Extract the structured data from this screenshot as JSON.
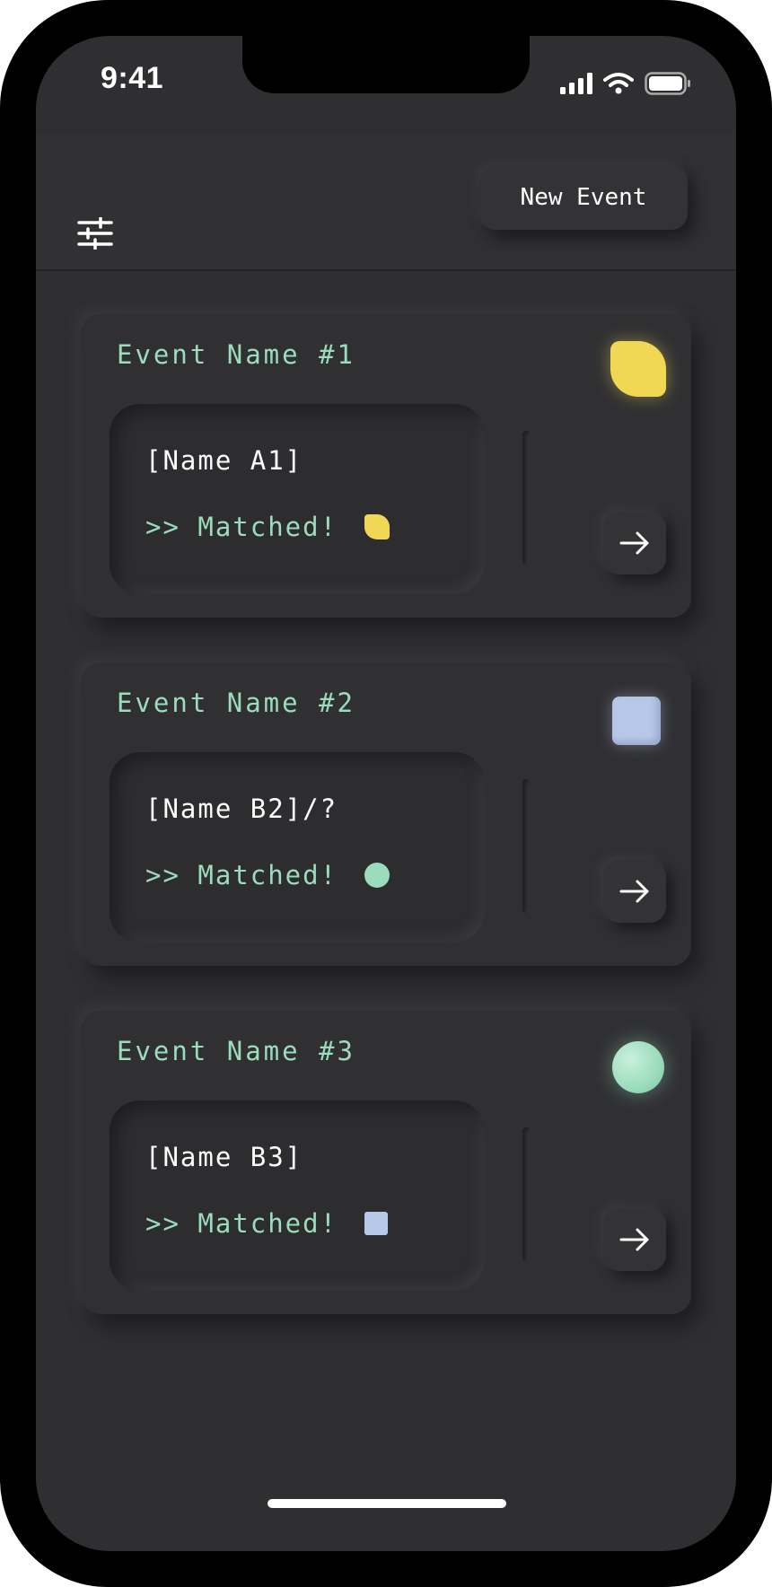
{
  "status_bar": {
    "time": "9:41"
  },
  "header": {
    "filter_icon": "sliders-icon",
    "new_event_label": "New Event"
  },
  "events": [
    {
      "title": "Event Name #1",
      "name": "[Name A1]",
      "status": ">> Matched!",
      "shape": "leaf",
      "shape_color": "#f0d855",
      "badge_shape": "leaf",
      "badge_color": "#f0d855"
    },
    {
      "title": "Event Name #2",
      "name": "[Name B2]/?",
      "status": ">> Matched!",
      "shape": "circle",
      "shape_color": "#9bdcbc",
      "badge_shape": "square",
      "badge_color": "#b7c8e8"
    },
    {
      "title": "Event Name #3",
      "name": "[Name B3]",
      "status": ">> Matched!",
      "shape": "square",
      "shape_color": "#b7c8e8",
      "badge_shape": "circle",
      "badge_color": "#9bdcbc"
    }
  ],
  "colors": {
    "background": "#2f2f32",
    "accent_green": "#9bdcbc",
    "accent_yellow": "#f0d855",
    "accent_blue": "#b7c8e8"
  }
}
